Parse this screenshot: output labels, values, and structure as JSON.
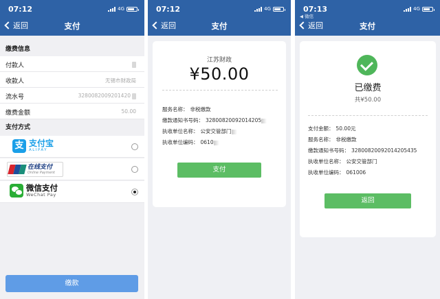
{
  "colors": {
    "nav_bar": "#2e62a6",
    "primary_button": "#5f9ce6",
    "success": "#5cbd64",
    "alipay": "#1a9fe8",
    "wechat": "#2aae36"
  },
  "phone1": {
    "status": {
      "time": "07:12",
      "network": "4G"
    },
    "nav": {
      "back": "返回",
      "title": "支付"
    },
    "fee_info": {
      "header": "缴费信息",
      "rows": [
        {
          "label": "付款人",
          "value": ""
        },
        {
          "label": "收款人",
          "value": "无锡市财政局"
        },
        {
          "label": "流水号",
          "value": "3280082009201420"
        },
        {
          "label": "缴费金额",
          "value": "50.00"
        }
      ]
    },
    "pay_methods": {
      "header": "支付方式",
      "alipay": {
        "cn": "支付宝",
        "en": "ALIPAY",
        "logo_char": "支",
        "selected": false
      },
      "unionpay": {
        "cn": "在线支付",
        "en": "Online Payment",
        "selected": false
      },
      "wechat": {
        "cn": "微信支付",
        "en": "WeChat Pay",
        "selected": true
      }
    },
    "submit": "缴款"
  },
  "phone2": {
    "status": {
      "time": "07:12",
      "network": "4G"
    },
    "nav": {
      "back": "返回",
      "title": "支付"
    },
    "org": "江苏财政",
    "amount": "¥50.00",
    "details": [
      {
        "label": "服务名称：",
        "value": "非税缴款"
      },
      {
        "label": "缴款通知书号码：",
        "value": "32800820092014205"
      },
      {
        "label": "执收单位名称：",
        "value": "公安交管部门"
      },
      {
        "label": "执收单位编码：",
        "value": "0610"
      }
    ],
    "pay_button": "支付"
  },
  "phone3": {
    "status": {
      "time": "07:13",
      "network": "4G",
      "back_app": "◀ 微信"
    },
    "nav": {
      "back": "返回",
      "title": "支付"
    },
    "paid_title": "已缴费",
    "paid_total": "共¥50.00",
    "details": [
      {
        "label": "支付金额：",
        "value": "50.00元"
      },
      {
        "label": "服务名称：",
        "value": "非税缴款"
      },
      {
        "label": "缴款通知书号码：",
        "value": "32800820092014205435"
      },
      {
        "label": "执收单位名称：",
        "value": "公安交管部门"
      },
      {
        "label": "执收单位编码：",
        "value": "061006"
      }
    ],
    "return_button": "返回"
  }
}
